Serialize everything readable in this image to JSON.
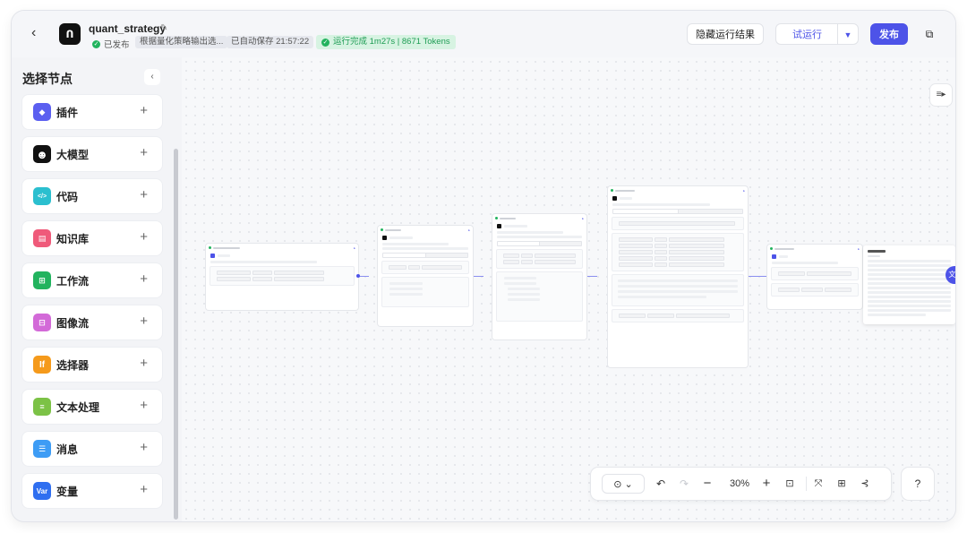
{
  "header": {
    "back_icon": "chevron-left-icon",
    "logo_text": "ᑎ",
    "title": "quant_strategy",
    "publish_status": "已发布",
    "description": "根据量化策略输出选...",
    "autosave": "已自动保存 21:57:22",
    "run_status": "运行完成 1m27s | 8671 Tokens",
    "hide_results_label": "隐藏运行结果",
    "try_run_label": "试运行",
    "publish_label": "发布",
    "accent_color": "#4d53e8",
    "success_color": "#22b35e"
  },
  "sidebar": {
    "title": "选择节点",
    "collapse_glyph": "‹",
    "items": [
      {
        "label": "插件",
        "icon": "cube-icon",
        "glyph": "◆",
        "color": "#5b5ff0"
      },
      {
        "label": "大模型",
        "icon": "llm-face-icon",
        "glyph": "☻",
        "color": "#111111"
      },
      {
        "label": "代码",
        "icon": "code-icon",
        "glyph": "</>",
        "color": "#2bbfcf"
      },
      {
        "label": "知识库",
        "icon": "knowledge-icon",
        "glyph": "▤",
        "color": "#ef5a7a"
      },
      {
        "label": "工作流",
        "icon": "workflow-icon",
        "glyph": "⊞",
        "color": "#22b35e"
      },
      {
        "label": "图像流",
        "icon": "imageflow-icon",
        "glyph": "⊟",
        "color": "#d36ad8"
      },
      {
        "label": "选择器",
        "icon": "if-icon",
        "glyph": "If",
        "color": "#f59a1b"
      },
      {
        "label": "文本处理",
        "icon": "text-process-icon",
        "glyph": "≡",
        "color": "#7cc246"
      },
      {
        "label": "消息",
        "icon": "message-icon",
        "glyph": "☰",
        "color": "#3d9cf5"
      },
      {
        "label": "变量",
        "icon": "variable-icon",
        "glyph": "Var",
        "color": "#2f6ff0"
      }
    ]
  },
  "toolbar": {
    "mouse_glyph": "⊙ ⌄",
    "undo_glyph": "↶",
    "redo_glyph": "↷",
    "minus_glyph": "−",
    "zoom": "30%",
    "plus_glyph": "+",
    "fit_glyph": "⊡",
    "collapse_glyph": "⤧",
    "layout_glyph": "⊞",
    "more_glyph": "⊰",
    "help_glyph": "?"
  }
}
